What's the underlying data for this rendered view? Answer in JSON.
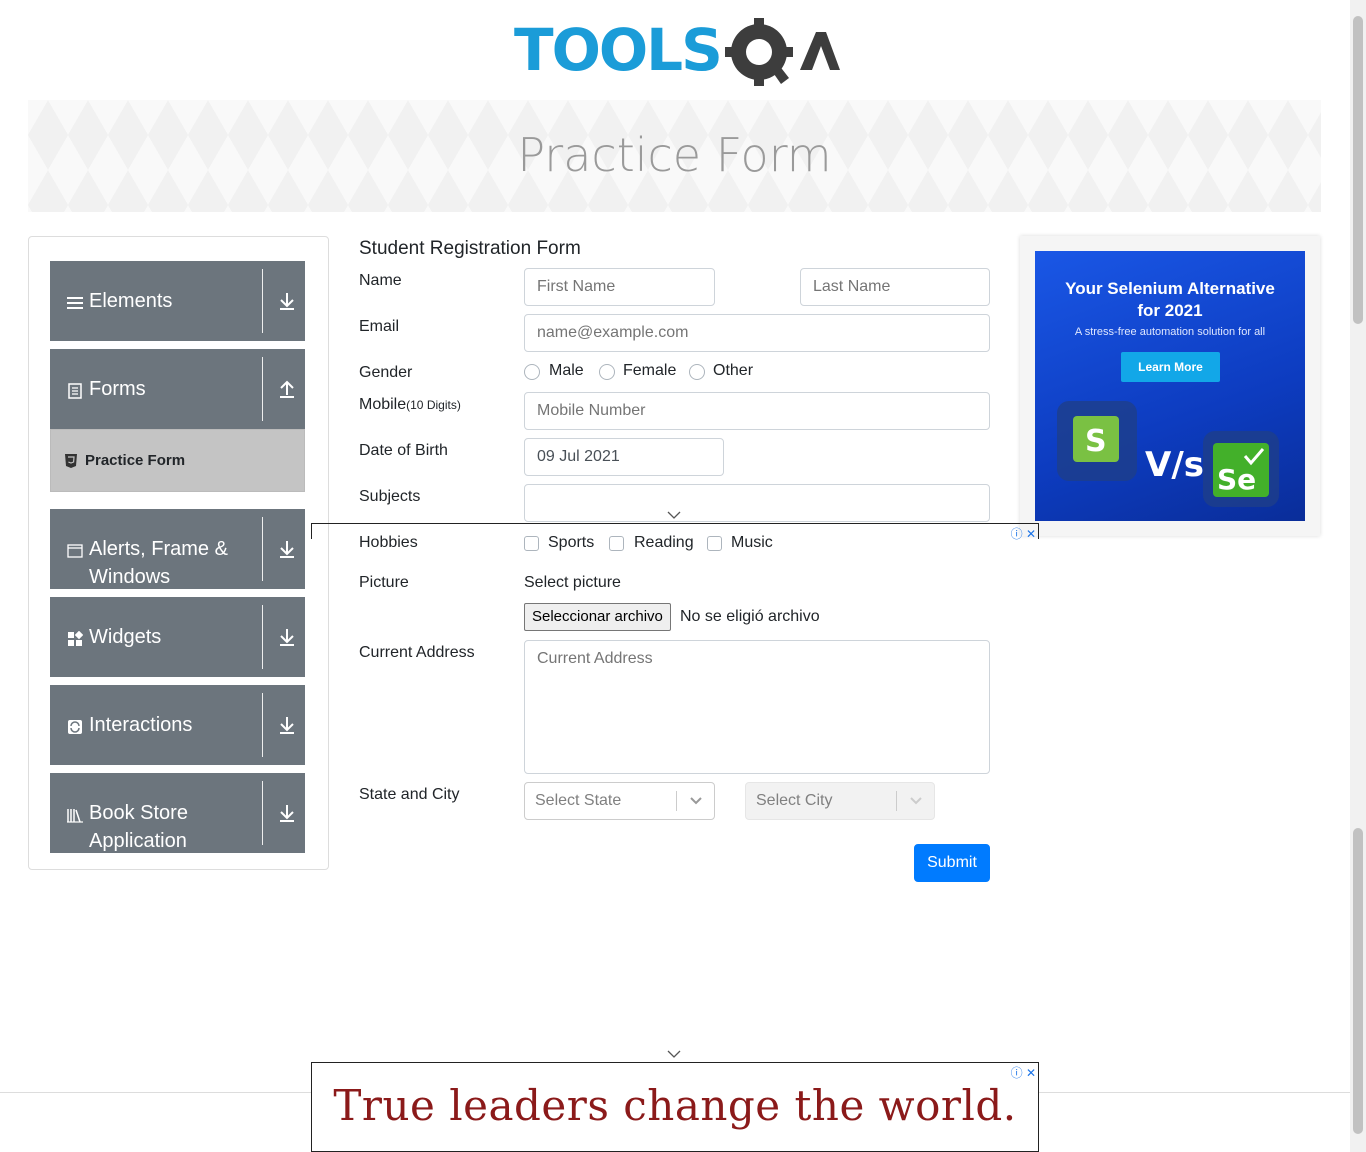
{
  "header": {
    "logo_text": "TOOLSQA"
  },
  "banner": {
    "title": "Practice Form"
  },
  "sidebar": {
    "groups": [
      {
        "label": "Elements",
        "icon": "menu-icon"
      },
      {
        "label": "Forms",
        "icon": "document-icon"
      },
      {
        "label": "Alerts, Frame & Windows",
        "icon": "window-icon"
      },
      {
        "label": "Widgets",
        "icon": "widgets-icon"
      },
      {
        "label": "Interactions",
        "icon": "interactions-icon"
      },
      {
        "label": "Book Store Application",
        "icon": "bookstore-icon"
      }
    ],
    "active_item": {
      "label": "Practice Form",
      "icon": "html5-icon"
    }
  },
  "form": {
    "title": "Student Registration Form",
    "name_label": "Name",
    "first_name_placeholder": "First Name",
    "last_name_placeholder": "Last Name",
    "email_label": "Email",
    "email_placeholder": "name@example.com",
    "gender_label": "Gender",
    "gender_options": [
      "Male",
      "Female",
      "Other"
    ],
    "mobile_label": "Mobile",
    "mobile_hint": "(10 Digits)",
    "mobile_placeholder": "Mobile Number",
    "dob_label": "Date of Birth",
    "dob_value": "09 Jul 2021",
    "subjects_label": "Subjects",
    "hobbies_label": "Hobbies",
    "hobbies": [
      "Sports",
      "Reading",
      "Music"
    ],
    "picture_label": "Picture",
    "picture_hint": "Select picture",
    "file_button": "Seleccionar archivo",
    "file_status": "No se eligió archivo",
    "address_label": "Current Address",
    "address_placeholder": "Current Address",
    "state_city_label": "State and City",
    "state_placeholder": "Select State",
    "city_placeholder": "Select City",
    "submit": "Submit"
  },
  "ads": {
    "right": {
      "title": "Your Selenium Alternative for 2021",
      "subtitle": "A stress-free automation solution for all",
      "button": "Learn More",
      "vs_text": "V/s",
      "left_logo": "S",
      "right_logo": "Se"
    },
    "bottom": {
      "text": "True leaders change the world."
    }
  },
  "colors": {
    "sidebar_bg": "#6c757d",
    "submit": "#007bff",
    "logo_blue": "#1b9cd8"
  }
}
